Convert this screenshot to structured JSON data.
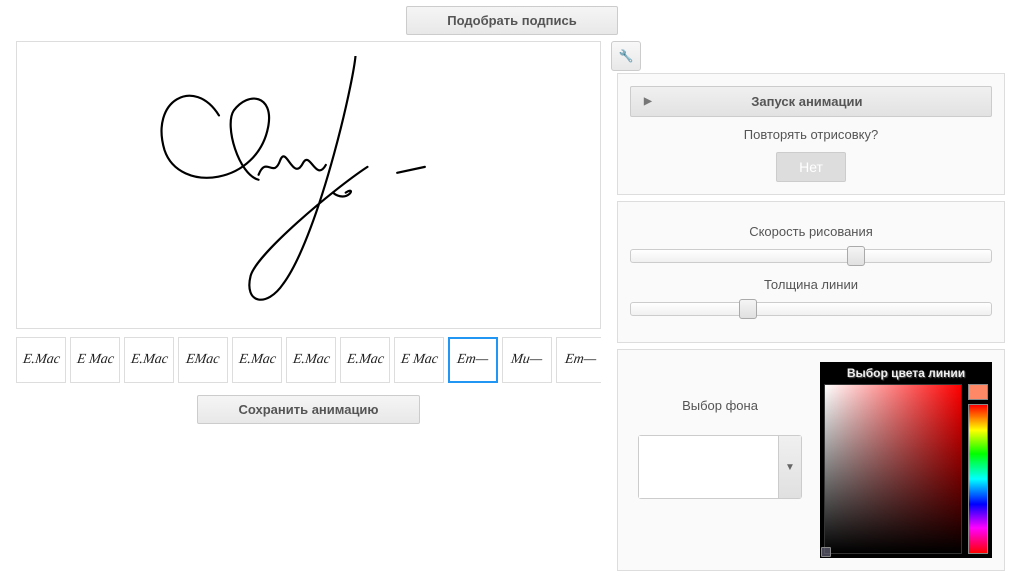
{
  "top": {
    "pick_signature": "Подобрать подпись"
  },
  "toolbar": {
    "wrench": "🔧"
  },
  "controls": {
    "run_animation": "Запуск анимации",
    "repeat_question": "Повторять отрисовку?",
    "no_label": "Нет",
    "speed_label": "Скорость рисования",
    "thickness_label": "Толщина линии",
    "bg_label": "Выбор фона",
    "line_color_label": "Выбор цвета линии",
    "speed_value": 60,
    "thickness_value": 30
  },
  "save": {
    "save_animation": "Сохранить анимацию"
  },
  "thumbs": {
    "items": [
      {
        "label": "E.Mac",
        "selected": false
      },
      {
        "label": "E Mac",
        "selected": false
      },
      {
        "label": "E.Mac",
        "selected": false
      },
      {
        "label": "EMac",
        "selected": false
      },
      {
        "label": "E.Mac",
        "selected": false
      },
      {
        "label": "E.Mac",
        "selected": false
      },
      {
        "label": "E.Mac",
        "selected": false
      },
      {
        "label": "E Mac",
        "selected": false
      },
      {
        "label": "Em—",
        "selected": true
      },
      {
        "label": "Mu—",
        "selected": false
      },
      {
        "label": "Em—",
        "selected": false
      }
    ]
  },
  "colors": {
    "bg_swatch": "#ffffff",
    "hue_preview": "#ff8866"
  }
}
